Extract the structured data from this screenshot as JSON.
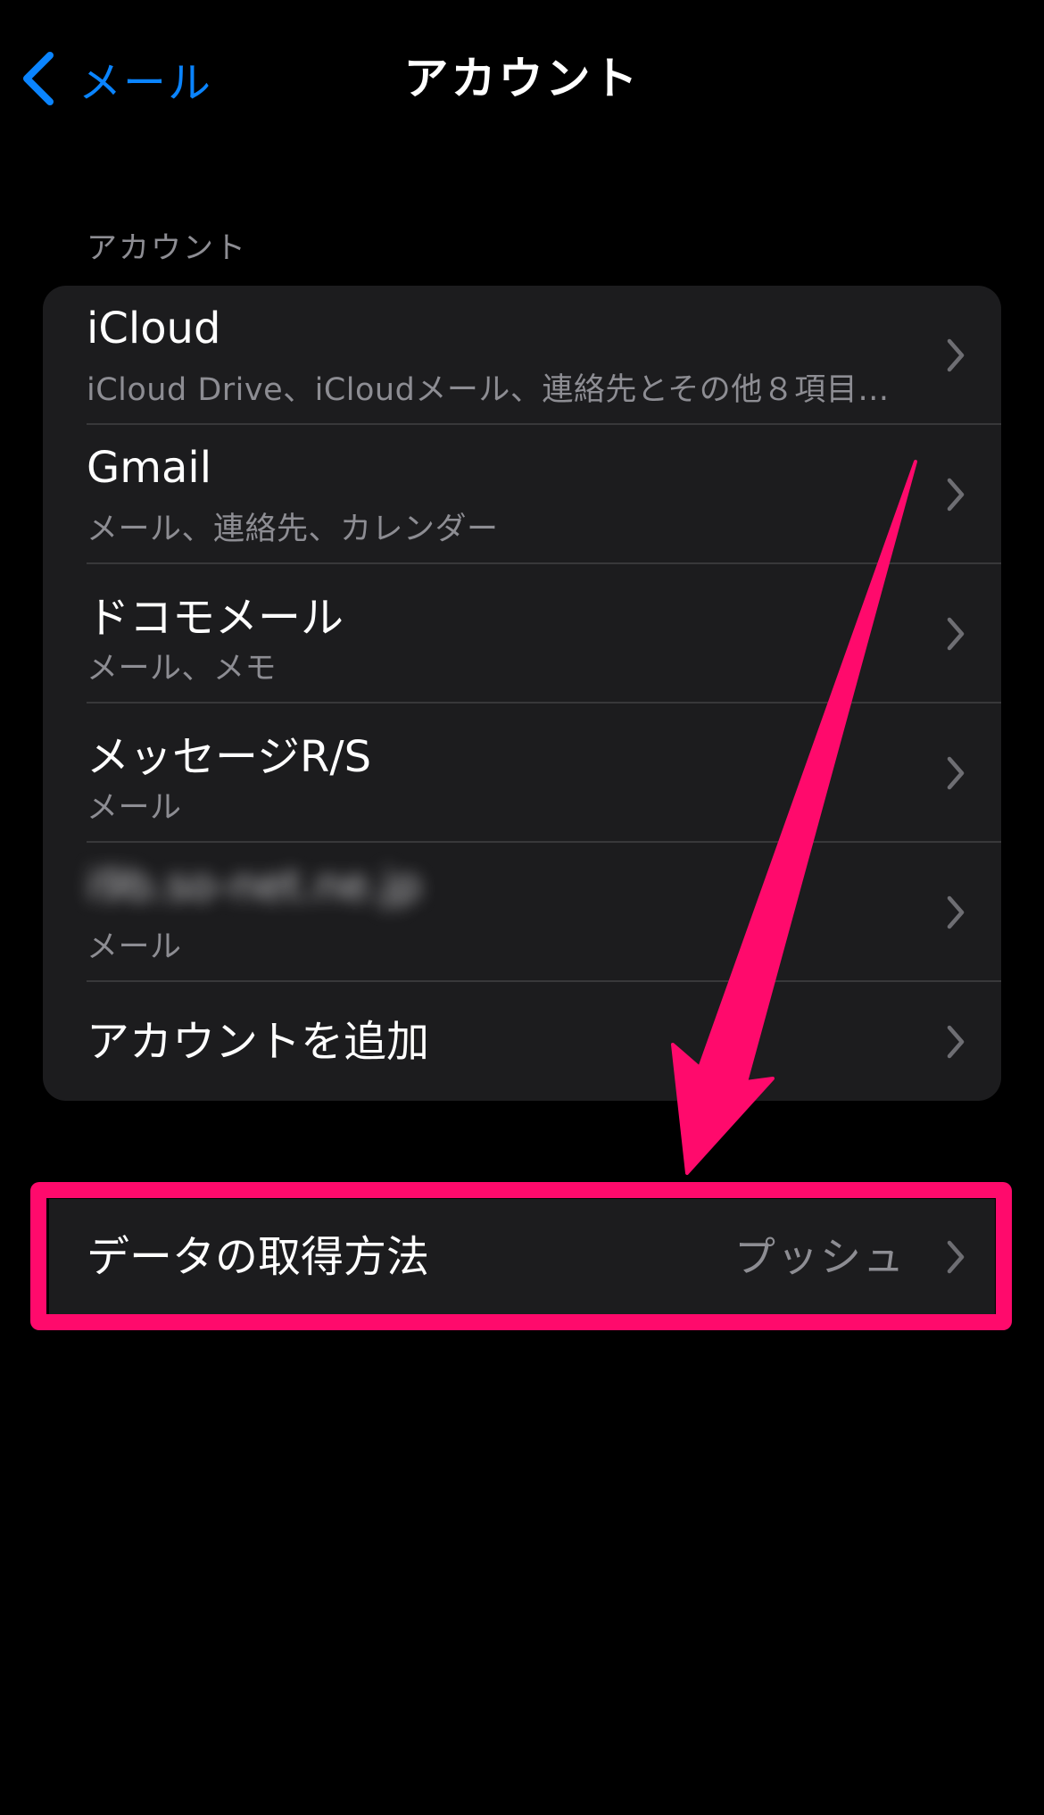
{
  "nav": {
    "back_label": "メール",
    "title": "アカウント"
  },
  "accounts_section": {
    "header": "アカウント",
    "items": [
      {
        "title": "iCloud",
        "subtitle": "iCloud Drive、iCloudメール、連絡先とその他８項目…"
      },
      {
        "title": "Gmail",
        "subtitle": "メール、連絡先、カレンダー"
      },
      {
        "title": "ドコモメール",
        "subtitle": "メール、メモ"
      },
      {
        "title": "メッセージR/S",
        "subtitle": "メール"
      },
      {
        "title": "i9b.so-net.ne.jp",
        "subtitle": "メール"
      }
    ],
    "add_account_label": "アカウントを追加"
  },
  "fetch": {
    "label": "データの取得方法",
    "value": "プッシュ"
  },
  "colors": {
    "accent": "#0a84ff",
    "background": "#000000",
    "cell_background": "#1c1c1e",
    "secondary_text": "#8d8d93",
    "separator": "#38383a",
    "annotation": "#ff0a6c"
  },
  "icons": {
    "back": "chevron-left-icon",
    "disclosure": "chevron-right-icon"
  }
}
